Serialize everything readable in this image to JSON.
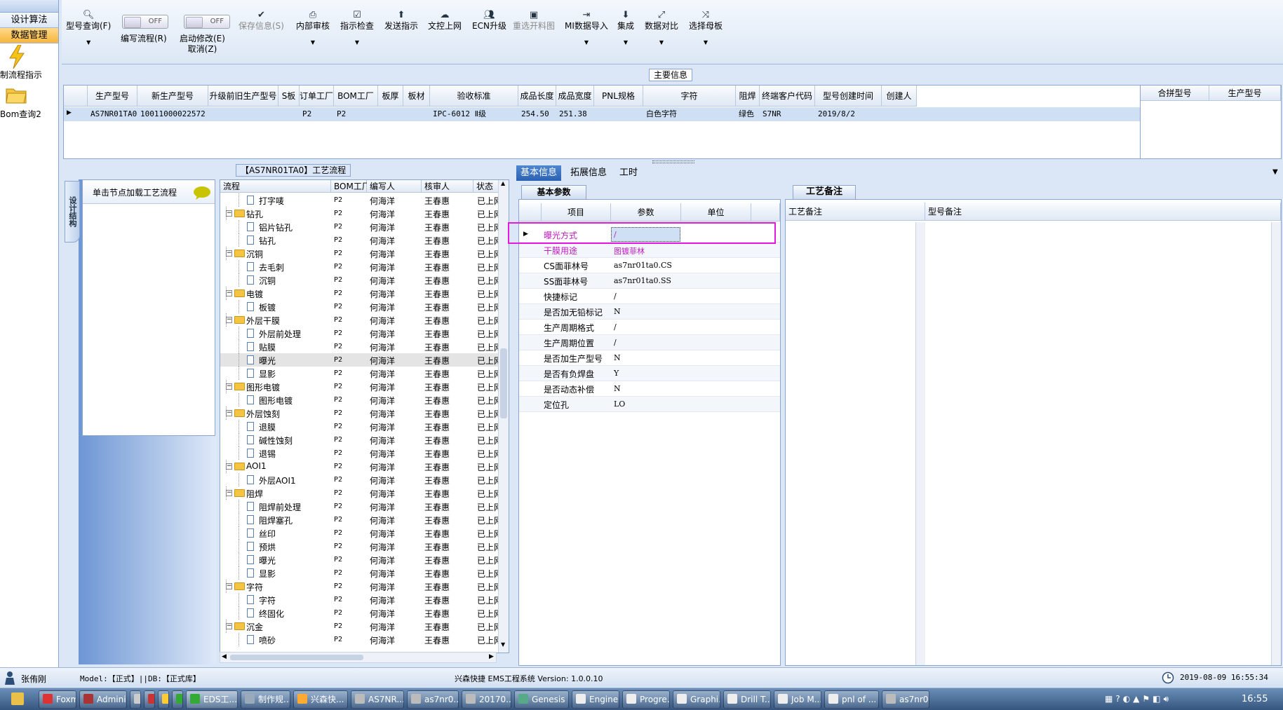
{
  "leftnav": {
    "items": [
      "设计算法",
      "数据管理"
    ],
    "icons": [
      {
        "name": "lightning-icon",
        "label": "制流程指示"
      },
      {
        "name": "folder-icon",
        "label": "Bom查询2"
      }
    ]
  },
  "toolbar": {
    "buttons": [
      {
        "label": "型号查询(F)",
        "icon": "search-icon"
      },
      {
        "label": "编写流程(R)",
        "toggle": "OFF"
      },
      {
        "label": "启动修改(E)",
        "label2": "取消(Z)",
        "toggle": "OFF"
      },
      {
        "label": "保存信息(S)",
        "icon": "check-icon"
      },
      {
        "label": "内部审核",
        "icon": "printer-icon"
      },
      {
        "label": "指示检查",
        "icon": "checkbox-icon"
      },
      {
        "label": "发送指示",
        "icon": "upload-icon"
      },
      {
        "label": "文控上网",
        "icon": "cloud-icon"
      },
      {
        "label": "ECN升级",
        "icon": "users-icon"
      },
      {
        "label": "重选开料图",
        "icon": "image-icon"
      },
      {
        "label": "MI数据导入",
        "icon": "import-icon"
      },
      {
        "label": "集成",
        "icon": "download-icon"
      },
      {
        "label": "数据对比",
        "icon": "compare-icon"
      },
      {
        "label": "选择母板",
        "icon": "shuffle-icon"
      }
    ]
  },
  "main_info": {
    "title": "主要信息",
    "headers": [
      "生产型号",
      "新生产型号",
      "升级前旧生产型号",
      "S板",
      "订单工厂",
      "BOM工厂",
      "板厚",
      "板材",
      "验收标准",
      "成品长度",
      "成品宽度",
      "PNL规格",
      "字符",
      "阻焊",
      "终端客户代码",
      "型号创建时间",
      "创建人"
    ],
    "row": [
      "AS7NR01TA0",
      "10011000022572",
      "",
      "",
      "P2",
      "P2",
      "",
      "",
      "IPC-6012 Ⅱ级",
      "254.50",
      "251.38",
      "",
      "白色字符",
      "绿色",
      "S7NR",
      "2019/8/2",
      ""
    ],
    "merge_headers": [
      "合拼型号",
      "生产型号"
    ]
  },
  "flow": {
    "title": "【AS7NR01TA0】工艺流程",
    "side_tab": "设计结构",
    "node_hint": "单击节点加载工艺流程",
    "headers": [
      "流程",
      "BOM工厂",
      "编写人",
      "核审人",
      "状态"
    ],
    "rows": [
      {
        "level": 2,
        "name": "打字唛",
        "bom": "P2",
        "writer": "何海洋",
        "reviewer": "王春惠",
        "status": "已上网"
      },
      {
        "level": 1,
        "name": "钻孔",
        "bom": "P2",
        "writer": "何海洋",
        "reviewer": "王春惠",
        "status": "已上网"
      },
      {
        "level": 2,
        "name": "铝片钻孔",
        "bom": "P2",
        "writer": "何海洋",
        "reviewer": "王春惠",
        "status": "已上网"
      },
      {
        "level": 2,
        "name": "钻孔",
        "bom": "P2",
        "writer": "何海洋",
        "reviewer": "王春惠",
        "status": "已上网"
      },
      {
        "level": 1,
        "name": "沉铜",
        "bom": "P2",
        "writer": "何海洋",
        "reviewer": "王春惠",
        "status": "已上网"
      },
      {
        "level": 2,
        "name": "去毛刺",
        "bom": "P2",
        "writer": "何海洋",
        "reviewer": "王春惠",
        "status": "已上网"
      },
      {
        "level": 2,
        "name": "沉铜",
        "bom": "P2",
        "writer": "何海洋",
        "reviewer": "王春惠",
        "status": "已上网"
      },
      {
        "level": 1,
        "name": "电镀",
        "bom": "P2",
        "writer": "何海洋",
        "reviewer": "王春惠",
        "status": "已上网"
      },
      {
        "level": 2,
        "name": "板镀",
        "bom": "P2",
        "writer": "何海洋",
        "reviewer": "王春惠",
        "status": "已上网"
      },
      {
        "level": 1,
        "name": "外层干膜",
        "bom": "P2",
        "writer": "何海洋",
        "reviewer": "王春惠",
        "status": "已上网"
      },
      {
        "level": 2,
        "name": "外层前处理",
        "bom": "P2",
        "writer": "何海洋",
        "reviewer": "王春惠",
        "status": "已上网"
      },
      {
        "level": 2,
        "name": "贴膜",
        "bom": "P2",
        "writer": "何海洋",
        "reviewer": "王春惠",
        "status": "已上网"
      },
      {
        "level": 2,
        "name": "曝光",
        "bom": "P2",
        "writer": "何海洋",
        "reviewer": "王春惠",
        "status": "已上网",
        "selected": true
      },
      {
        "level": 2,
        "name": "显影",
        "bom": "P2",
        "writer": "何海洋",
        "reviewer": "王春惠",
        "status": "已上网"
      },
      {
        "level": 1,
        "name": "图形电镀",
        "bom": "P2",
        "writer": "何海洋",
        "reviewer": "王春惠",
        "status": "已上网"
      },
      {
        "level": 2,
        "name": "图形电镀",
        "bom": "P2",
        "writer": "何海洋",
        "reviewer": "王春惠",
        "status": "已上网"
      },
      {
        "level": 1,
        "name": "外层蚀刻",
        "bom": "P2",
        "writer": "何海洋",
        "reviewer": "王春惠",
        "status": "已上网"
      },
      {
        "level": 2,
        "name": "退膜",
        "bom": "P2",
        "writer": "何海洋",
        "reviewer": "王春惠",
        "status": "已上网"
      },
      {
        "level": 2,
        "name": "碱性蚀刻",
        "bom": "P2",
        "writer": "何海洋",
        "reviewer": "王春惠",
        "status": "已上网"
      },
      {
        "level": 2,
        "name": "退锡",
        "bom": "P2",
        "writer": "何海洋",
        "reviewer": "王春惠",
        "status": "已上网"
      },
      {
        "level": 1,
        "name": "AOI1",
        "bom": "P2",
        "writer": "何海洋",
        "reviewer": "王春惠",
        "status": "已上网"
      },
      {
        "level": 2,
        "name": "外层AOI1",
        "bom": "P2",
        "writer": "何海洋",
        "reviewer": "王春惠",
        "status": "已上网"
      },
      {
        "level": 1,
        "name": "阻焊",
        "bom": "P2",
        "writer": "何海洋",
        "reviewer": "王春惠",
        "status": "已上网"
      },
      {
        "level": 2,
        "name": "阻焊前处理",
        "bom": "P2",
        "writer": "何海洋",
        "reviewer": "王春惠",
        "status": "已上网"
      },
      {
        "level": 2,
        "name": "阻焊塞孔",
        "bom": "P2",
        "writer": "何海洋",
        "reviewer": "王春惠",
        "status": "已上网"
      },
      {
        "level": 2,
        "name": "丝印",
        "bom": "P2",
        "writer": "何海洋",
        "reviewer": "王春惠",
        "status": "已上网"
      },
      {
        "level": 2,
        "name": "预烘",
        "bom": "P2",
        "writer": "何海洋",
        "reviewer": "王春惠",
        "status": "已上网"
      },
      {
        "level": 2,
        "name": "曝光",
        "bom": "P2",
        "writer": "何海洋",
        "reviewer": "王春惠",
        "status": "已上网"
      },
      {
        "level": 2,
        "name": "显影",
        "bom": "P2",
        "writer": "何海洋",
        "reviewer": "王春惠",
        "status": "已上网"
      },
      {
        "level": 1,
        "name": "字符",
        "bom": "P2",
        "writer": "何海洋",
        "reviewer": "王春惠",
        "status": "已上网"
      },
      {
        "level": 2,
        "name": "字符",
        "bom": "P2",
        "writer": "何海洋",
        "reviewer": "王春惠",
        "status": "已上网"
      },
      {
        "level": 2,
        "name": "终固化",
        "bom": "P2",
        "writer": "何海洋",
        "reviewer": "王春惠",
        "status": "已上网"
      },
      {
        "level": 1,
        "name": "沉金",
        "bom": "P2",
        "writer": "何海洋",
        "reviewer": "王春惠",
        "status": "已上网"
      },
      {
        "level": 2,
        "name": "喷砂",
        "bom": "P2",
        "writer": "何海洋",
        "reviewer": "王春惠",
        "status": "已上网"
      }
    ]
  },
  "params": {
    "tabs": [
      "基本信息",
      "拓展信息",
      "工时"
    ],
    "subtab": "基本参数",
    "headers": [
      "项目",
      "参数",
      "单位"
    ],
    "rows": [
      {
        "item": "曝光方式",
        "value": "/",
        "highlight": true
      },
      {
        "item": "干膜用途",
        "value": "图镀菲林",
        "highlight": true
      },
      {
        "item": "CS面菲林号",
        "value": "as7nr01ta0.CS"
      },
      {
        "item": "SS面菲林号",
        "value": "as7nr01ta0.SS"
      },
      {
        "item": "快捷标记",
        "value": "/"
      },
      {
        "item": "是否加无铅标记",
        "value": "N"
      },
      {
        "item": "生产周期格式",
        "value": "/"
      },
      {
        "item": "生产周期位置",
        "value": "/"
      },
      {
        "item": "是否加生产型号",
        "value": "N"
      },
      {
        "item": "是否有负焊盘",
        "value": "Y"
      },
      {
        "item": "是否动态补偿",
        "value": "N"
      },
      {
        "item": "定位孔",
        "value": "LO"
      }
    ],
    "highlight_color": "#c01ac0"
  },
  "remarks": {
    "subtab": "工艺备注",
    "headers": [
      "工艺备注",
      "型号备注"
    ]
  },
  "status": {
    "user": "张侑刚",
    "model_db": "Model:【正式】||DB:【正式库】",
    "system": "兴森快捷 EMS工程系统 Version: 1.0.0.10",
    "datetime": "2019-08-09 16:55:34"
  },
  "taskbar": {
    "tasks": [
      {
        "label": "Foxmail",
        "color": "#d33"
      },
      {
        "label": "Admini...",
        "color": "#a33"
      },
      {
        "label": "",
        "color": "#ccc"
      },
      {
        "label": "",
        "color": "#c33"
      },
      {
        "label": "",
        "color": "#fc3"
      },
      {
        "label": "",
        "color": "#3a3"
      },
      {
        "label": "EDS工...",
        "color": "#3a3",
        "active": true
      },
      {
        "label": "制作规...",
        "color": "#9ab"
      },
      {
        "label": "兴森快...",
        "color": "#fa3"
      },
      {
        "label": "AS7NR...",
        "color": "#bbb"
      },
      {
        "label": "as7nr0...",
        "color": "#bbb"
      },
      {
        "label": "20170...",
        "color": "#bbb"
      },
      {
        "label": "Genesis",
        "color": "#5a8"
      },
      {
        "label": "Engine...",
        "color": "#eee"
      },
      {
        "label": "Progre...",
        "color": "#eee"
      },
      {
        "label": "Graphi...",
        "color": "#eee"
      },
      {
        "label": "Drill T...",
        "color": "#eee"
      },
      {
        "label": "Job M...",
        "color": "#eee"
      },
      {
        "label": "pnl of ...",
        "color": "#eee"
      },
      {
        "label": "as7nr0...",
        "color": "#bbb"
      }
    ],
    "clock": "16:55"
  }
}
